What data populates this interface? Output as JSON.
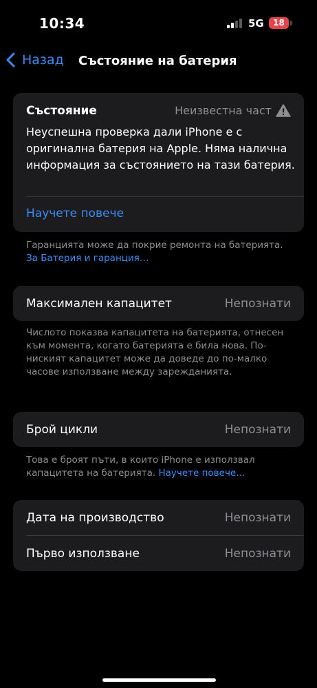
{
  "status_bar": {
    "time": "10:34",
    "network": "5G",
    "battery_level": "18"
  },
  "nav": {
    "back_label": "Назад",
    "title": "Състояние на батерия"
  },
  "state_card": {
    "heading": "Състояние",
    "value": "Неизвестна част",
    "description": "Неуспешна проверка дали iPhone е с оригинална батерия на Apple. Няма налична информация за състоянието на тази батерия.",
    "learn_more": "Научете повече"
  },
  "warranty_note": {
    "text": "Гаранцията може да покрие ремонта на батерията.",
    "link": "За Батерия и гаранция…"
  },
  "capacity": {
    "label": "Максимален капацитет",
    "value": "Непознати",
    "note": "Числото показва капацитета на батерията, отнесен към момента, когато батерията е била нова. По-ниският капацитет може да доведе до по-малко часове използване между зарежданията."
  },
  "cycles": {
    "label": "Брой цикли",
    "value": "Непознати",
    "note": "Това е броят пъти, в които iPhone е използвал капацитета на батерията.",
    "note_link": "Научете повече…"
  },
  "dates": {
    "manufacture_label": "Дата на производство",
    "manufacture_value": "Непознати",
    "first_use_label": "Първо използване",
    "first_use_value": "Непознати"
  },
  "colors": {
    "accent": "#3a8df5",
    "card": "#1c1c1e",
    "secondary_text": "#8e8e93",
    "battery_badge": "#e5444b"
  }
}
